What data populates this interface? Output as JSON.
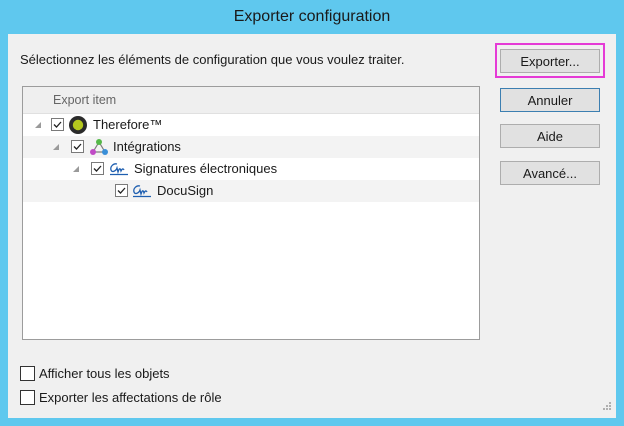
{
  "window": {
    "title": "Exporter configuration"
  },
  "instruction": "Sélectionnez les éléments de configuration que vous voulez traiter.",
  "tree": {
    "column_header": "Export item",
    "items": [
      {
        "label": "Therefore™",
        "icon": "therefore-logo-icon",
        "checked": true,
        "level": 0
      },
      {
        "label": "Intégrations",
        "icon": "integrations-icon",
        "checked": true,
        "level": 1
      },
      {
        "label": "Signatures électroniques",
        "icon": "signature-icon",
        "checked": true,
        "level": 2
      },
      {
        "label": "DocuSign",
        "icon": "signature-icon",
        "checked": true,
        "level": 3
      }
    ]
  },
  "buttons": {
    "export": "Exporter...",
    "cancel": "Annuler",
    "help": "Aide",
    "advanced": "Avancé..."
  },
  "options": {
    "show_all": {
      "label": "Afficher tous les objets",
      "checked": false
    },
    "export_roles": {
      "label": "Exporter les affectations de rôle",
      "checked": false
    }
  },
  "colors": {
    "titlebar": "#5fc8ee",
    "highlight": "#e53bd6",
    "dialog_bg": "#f0f0f0"
  }
}
